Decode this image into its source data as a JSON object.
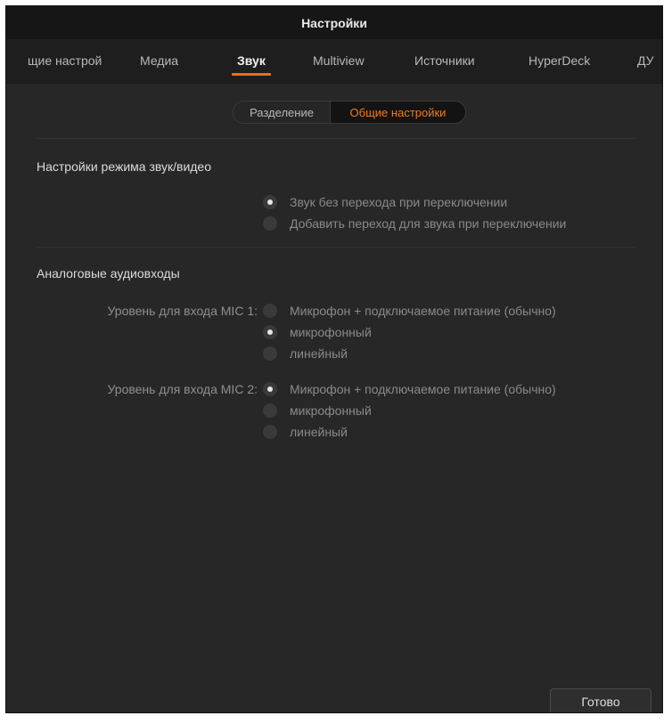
{
  "window": {
    "title": "Настройки"
  },
  "tabs": [
    {
      "label": "щие настрой"
    },
    {
      "label": "Медиа"
    },
    {
      "label": "Звук",
      "active": true
    },
    {
      "label": "Multiview"
    },
    {
      "label": "Источники"
    },
    {
      "label": "HyperDeck"
    },
    {
      "label": "ДУ"
    }
  ],
  "segment": {
    "left": "Разделение",
    "right": "Общие настройки",
    "selected": "right"
  },
  "av_mode": {
    "title": "Настройки режима звук/видео",
    "options": [
      {
        "label": "Звук без перехода при переключении",
        "checked": true
      },
      {
        "label": "Добавить переход для звука при переключении",
        "checked": false
      }
    ]
  },
  "analog": {
    "title": "Аналоговые аудиовходы",
    "mic1": {
      "label": "Уровень для входа MIC 1:",
      "options": [
        {
          "label": "Микрофон + подключаемое питание (обычно)",
          "checked": false
        },
        {
          "label": "микрофонный",
          "checked": true
        },
        {
          "label": "линейный",
          "checked": false
        }
      ]
    },
    "mic2": {
      "label": "Уровень для входа MIC 2:",
      "options": [
        {
          "label": "Микрофон + подключаемое питание (обычно)",
          "checked": true
        },
        {
          "label": "микрофонный",
          "checked": false
        },
        {
          "label": "линейный",
          "checked": false
        }
      ]
    }
  },
  "footer": {
    "done_label": "Готово"
  },
  "colors": {
    "accent": "#f07a20",
    "background": "#272727",
    "titlebar": "#161616"
  }
}
